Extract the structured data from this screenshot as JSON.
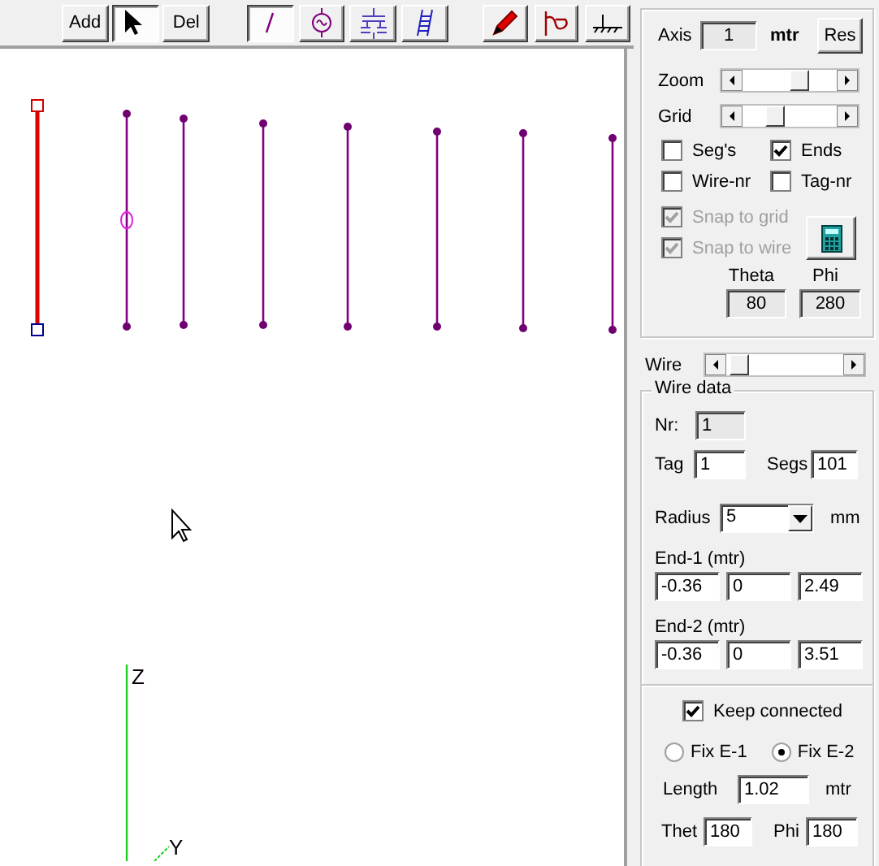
{
  "toolbar": {
    "buttons": [
      {
        "kind": "text",
        "label": "Add",
        "selected": false
      },
      {
        "kind": "pointer",
        "selected": true
      },
      {
        "kind": "text",
        "label": "Del",
        "selected": false
      }
    ],
    "tools": [
      {
        "kind": "wire",
        "selected": true
      },
      {
        "kind": "source",
        "selected": false
      },
      {
        "kind": "load",
        "selected": false
      },
      {
        "kind": "ladder",
        "selected": false
      }
    ],
    "actions": [
      {
        "kind": "pencil"
      },
      {
        "kind": "pattern"
      },
      {
        "kind": "ground"
      }
    ]
  },
  "canvas": {
    "wires": [
      {
        "selected": true,
        "source": false
      },
      {
        "selected": false,
        "source": true
      },
      {
        "selected": false,
        "source": false
      },
      {
        "selected": false,
        "source": false
      },
      {
        "selected": false,
        "source": false
      },
      {
        "selected": false,
        "source": false
      },
      {
        "selected": false,
        "source": false
      },
      {
        "selected": false,
        "source": false
      }
    ],
    "axis_labels": [
      "Z",
      "Y"
    ]
  },
  "view": {
    "axis_label": "Axis",
    "axis_value": "1",
    "axis_unit": "mtr",
    "reset_button": "Res",
    "zoom": {
      "label": "Zoom",
      "level": 0.62
    },
    "grid": {
      "label": "Grid",
      "level": 0.3
    },
    "options": [
      {
        "label": "Seg's",
        "checked": false
      },
      {
        "label": "Ends",
        "checked": true
      },
      {
        "label": "Wire-nr",
        "checked": false
      },
      {
        "label": "Tag-nr",
        "checked": false
      }
    ],
    "snaps": [
      {
        "label": "Snap to grid",
        "checked": true,
        "disabled": true
      },
      {
        "label": "Snap to wire",
        "checked": true,
        "disabled": true
      }
    ],
    "theta_label": "Theta",
    "phi_label": "Phi",
    "theta": "80",
    "phi": "280"
  },
  "wire_scroll": {
    "label": "Wire"
  },
  "wire_data": {
    "title": "Wire data",
    "nr_label": "Nr:",
    "nr": "1",
    "tag_label": "Tag",
    "tag": "1",
    "segs_label": "Segs",
    "segs": "101",
    "radius_label": "Radius",
    "radius": "5",
    "radius_unit": "mm",
    "end1_label": "End-1 (mtr)",
    "end1": [
      "-0.36",
      "0",
      "2.49"
    ],
    "end2_label": "End-2 (mtr)",
    "end2": [
      "-0.36",
      "0",
      "3.51"
    ],
    "keep_connected": {
      "label": "Keep connected",
      "checked": true
    },
    "fix": [
      {
        "label": "Fix E-1",
        "selected": false
      },
      {
        "label": "Fix E-2",
        "selected": true
      }
    ],
    "length_label": "Length",
    "length": "1.02",
    "length_unit": "mtr",
    "theta_label": "Thet",
    "theta": "180",
    "phi_label": "Phi",
    "phi": "180"
  }
}
